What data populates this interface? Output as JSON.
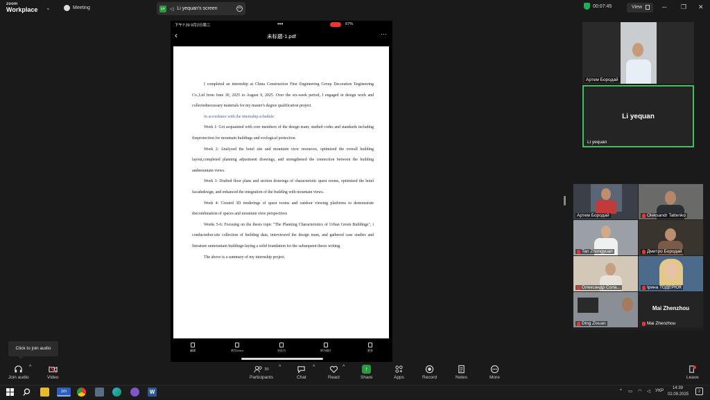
{
  "topbar": {
    "logo_small": "zoom",
    "logo_big": "Workplace",
    "meeting_label": "Meeting",
    "share_tab_badge": "LY",
    "share_tab_label": "Li yequan's screen",
    "timer": "00:07:45",
    "view_label": "View"
  },
  "phone": {
    "status_time": "下午7:39  9月2日周二",
    "status_right": "67%",
    "pdf_title": "未标题-1.pdf",
    "toolbar": [
      "编辑",
      "转为Word",
      "另存为",
      "转为图片",
      "更多"
    ]
  },
  "document": {
    "paragraphs": [
      "I completed an internship at China Construction First Engineering Group Decoration Engineering Co.,Ltd from June 30, 2025 to August 9, 2025. Over the six-week period, I engaged in design work and collectednecessary materials for my master's degree qualification project.",
      "In accordance with the internship schedule:",
      "Week 1: Got acquainted with core members of the design team; studied codes and standards including fireprotection for mountain buildings and ecological protection.",
      "Week 2: Analyzed the hotel site and mountain view resources, optimized the overall building layout,completed planning adjustment drawings, and strengthened the connection between the building andmountain views.",
      "Week 3: Drafted floor plans and section drawings of characteristic quest rooms, optimized the hotel facadedesign, and enhanced the integration of the building with mountain views.",
      "Week 4: Created 3D renderings of quest rooms and outdoor viewing platforms to demonstrate thecombination of spaces and mountain view perspectives",
      "Weeks 5-6: Focusing on the thesis topic \"The Planning Characteristics of Urban Green Buildings\", i conductedon-site collection of building data, interviewed the design team, and gathered case studies and literature onmountain buildings-laying a solid foundation for the subsequent thesis writing.",
      "The above is a summary of my internship project."
    ]
  },
  "participants_top": [
    {
      "name": "Артем Бородай"
    },
    {
      "name": "Li yequan",
      "display": "Li yequan"
    }
  ],
  "gallery": [
    {
      "name": "Артем Бородай"
    },
    {
      "name": "Oleksandr Tattenko"
    },
    {
      "name": "Tan Zhongyuan"
    },
    {
      "name": "Дмитро Бородай"
    },
    {
      "name": "Олександр Сола..."
    },
    {
      "name": "Ірина ТОДЕРЮК"
    },
    {
      "name": "Ding Zixuan"
    },
    {
      "name": "Mai Zhenzhou",
      "display": "Mai Zhenzhou"
    }
  ],
  "bottombar": {
    "tooltip": "Click to join audio",
    "join_audio": "Join audio",
    "video": "Video",
    "participants": "Participants",
    "participants_count": "30",
    "chat": "Chat",
    "react": "React",
    "share": "Share",
    "apps": "Apps",
    "record": "Record",
    "notes": "Notes",
    "more": "More",
    "leave": "Leave"
  },
  "taskbar": {
    "app_zm": "zm",
    "app_word": "W",
    "lang": "УКР",
    "time": "14:39",
    "date": "02.09.2025",
    "notif_count": "2"
  },
  "colors": {
    "accent_green": "#2a9a3e",
    "active_border": "#3fc35e",
    "leave_red": "#e33"
  }
}
